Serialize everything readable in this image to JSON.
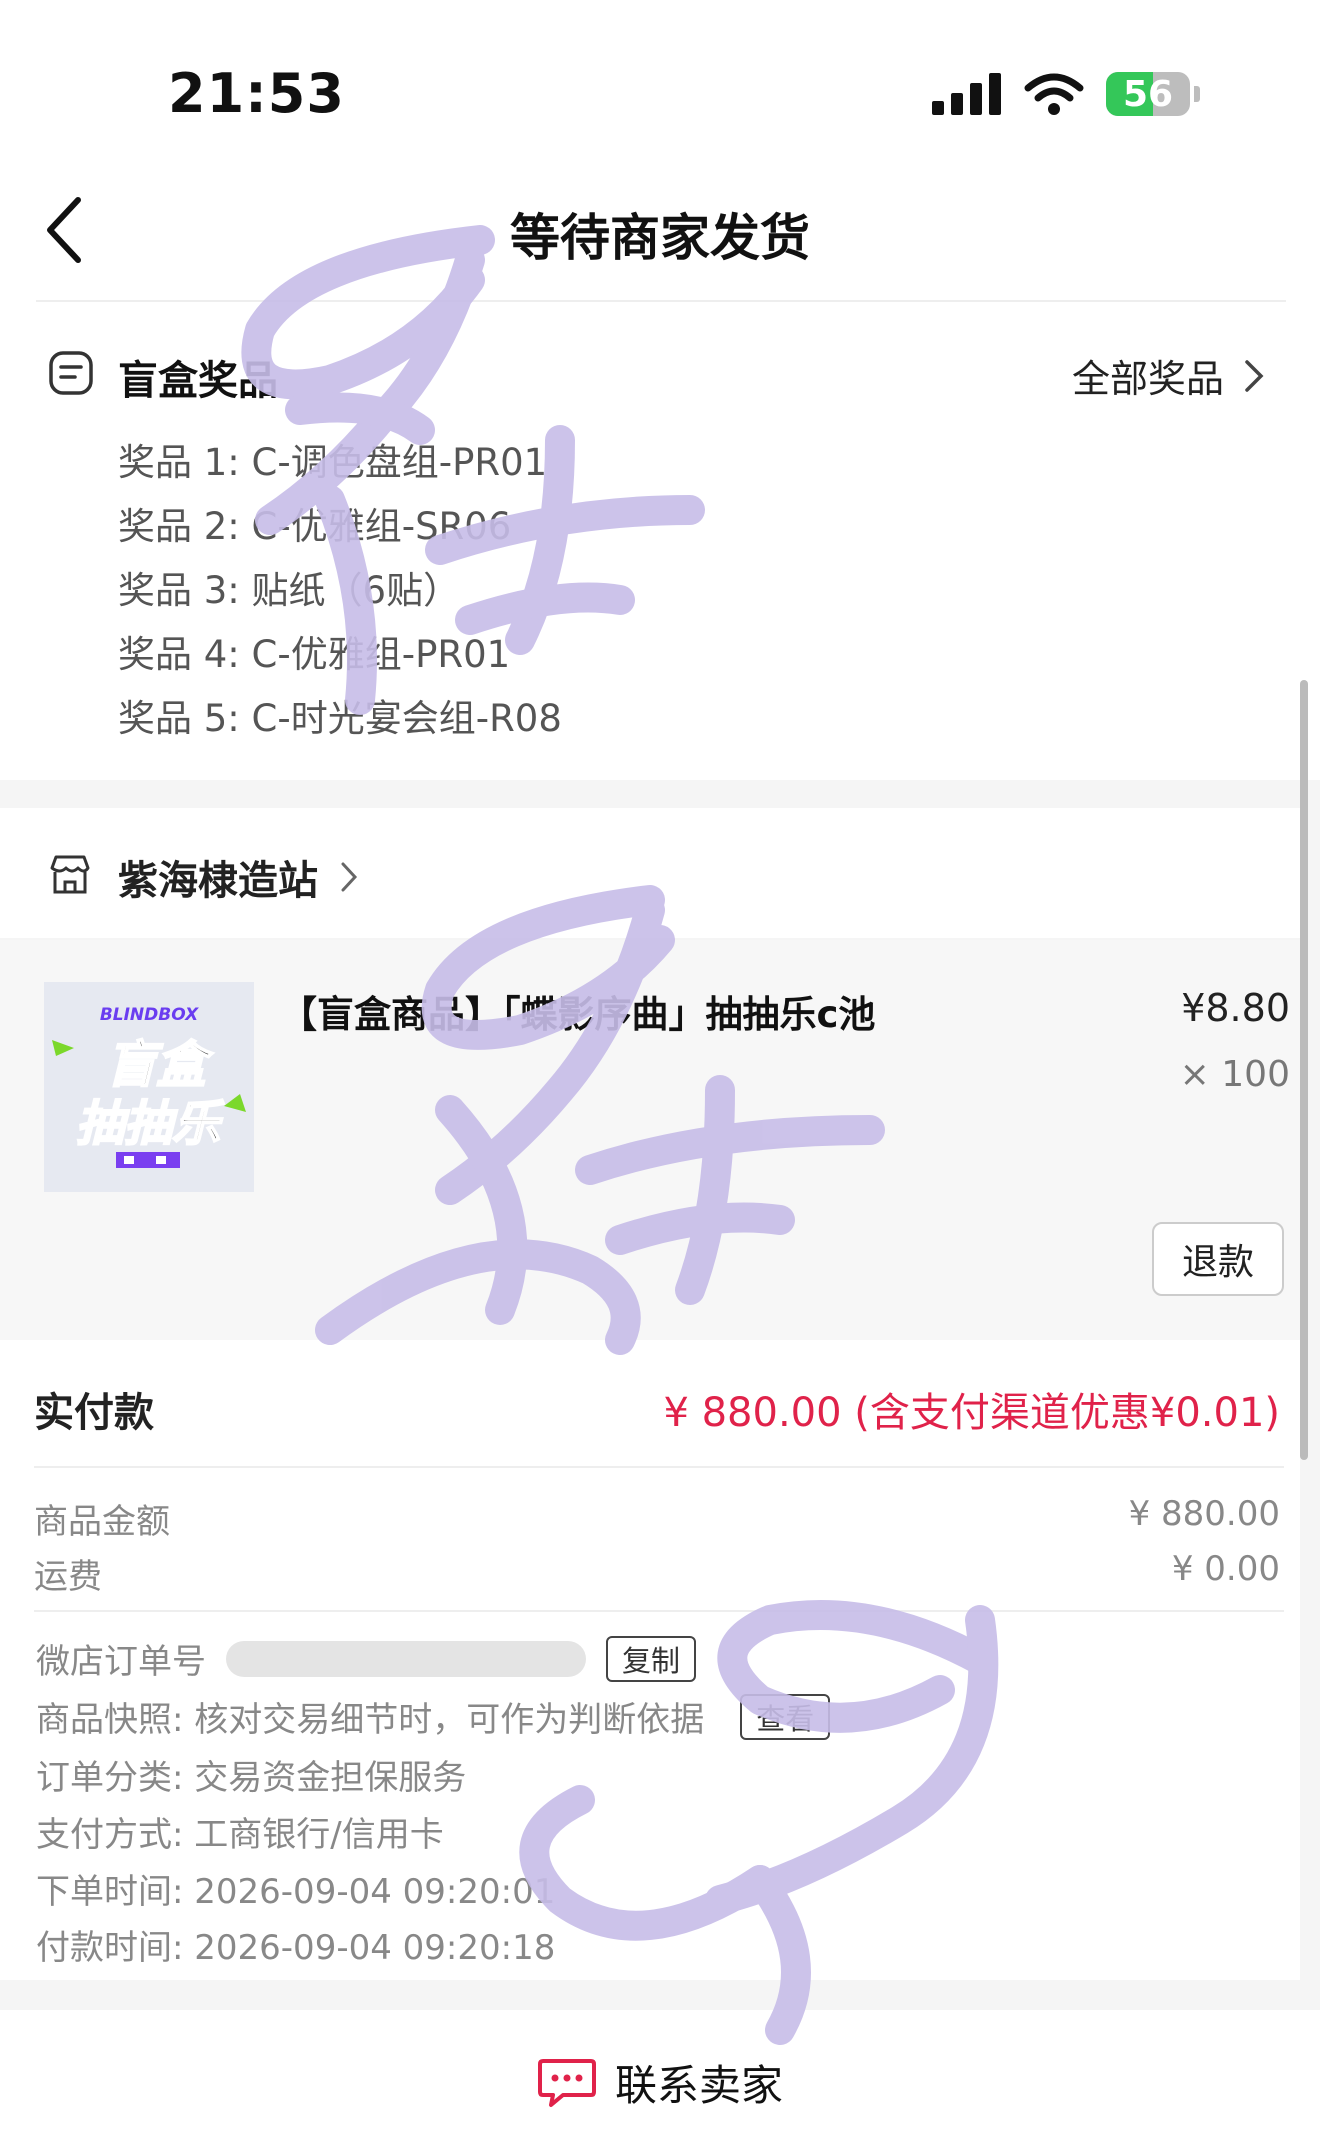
{
  "status_bar": {
    "time": "21:53",
    "battery": "56"
  },
  "nav": {
    "title": "等待商家发货"
  },
  "prizes": {
    "header": "盲盒奖品",
    "all_link": "全部奖品",
    "items": [
      "奖品 1: C-调色盘组-PR01",
      "奖品 2: C-优雅组-SR06",
      "奖品 3: 贴纸（6贴）",
      "奖品 4: C-优雅组-PR01",
      "奖品 5: C-时光宴会组-R08"
    ]
  },
  "store": {
    "name": "紫海棣造站"
  },
  "product": {
    "title": "【盲盒商品】「蝶影序曲」抽抽乐c池",
    "price": "¥8.80",
    "quantity": "× 100",
    "refund_label": "退款",
    "thumb_tag": "BLINDBOX",
    "thumb_line1": "盲盒",
    "thumb_line2": "抽抽乐"
  },
  "payment": {
    "label": "实付款",
    "amount": "¥ 880.00 (含支付渠道优惠¥0.01)",
    "goods_label": "商品金额",
    "goods_value": "¥ 880.00",
    "shipping_label": "运费",
    "shipping_value": "¥ 0.00"
  },
  "details": {
    "order_no_label": "微店订单号",
    "copy_label": "复制",
    "snapshot_text": "商品快照: 核对交易细节时，可作为判断依据",
    "view_label": "查看",
    "category": "订单分类:  交易资金担保服务",
    "pay_method": "支付方式:  工商银行/信用卡",
    "order_time": "下单时间:  2026-09-04 09:20:01",
    "pay_time": "付款时间:  2026-09-04 09:20:18"
  },
  "bottom": {
    "contact_label": "联系卖家"
  },
  "colors": {
    "price_red": "#e0224a",
    "watermark": "#c7bde8",
    "battery_green": "#34c759"
  }
}
